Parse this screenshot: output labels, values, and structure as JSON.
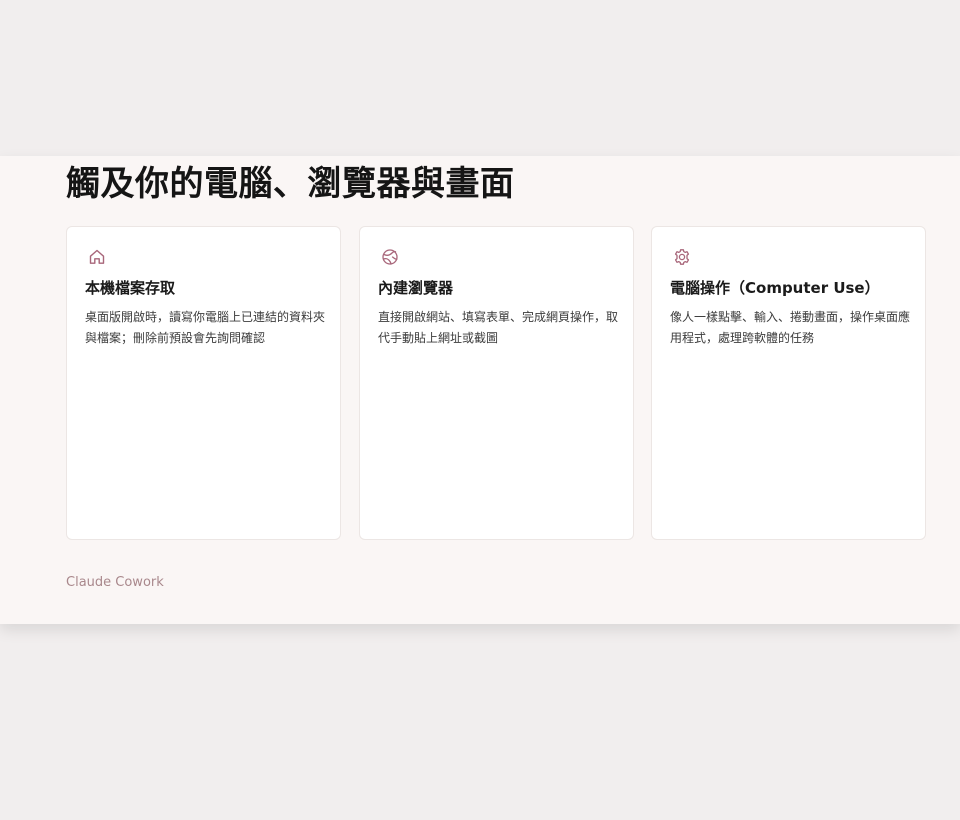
{
  "heading": "觸及你的電腦、瀏覽器與畫面",
  "cards": [
    {
      "icon": "home-icon",
      "title": "本機檔案存取",
      "description": "桌面版開啟時，讀寫你電腦上已連結的資料夾與檔案；刪除前預設會先詢問確認"
    },
    {
      "icon": "globe-icon",
      "title": "內建瀏覽器",
      "description": "直接開啟網站、填寫表單、完成網頁操作，取代手動貼上網址或截圖"
    },
    {
      "icon": "gear-icon",
      "title": "電腦操作（Computer Use）",
      "description": "像人一樣點擊、輸入、捲動畫面，操作桌面應用程式，處理跨軟體的任務"
    }
  ],
  "footer": "Claude Cowork",
  "colors": {
    "accent_icon": "#a8667a",
    "page_background": "#f1eeee",
    "panel_background": "#faf6f5",
    "card_background": "#ffffff",
    "footer_text": "#a9888c"
  }
}
